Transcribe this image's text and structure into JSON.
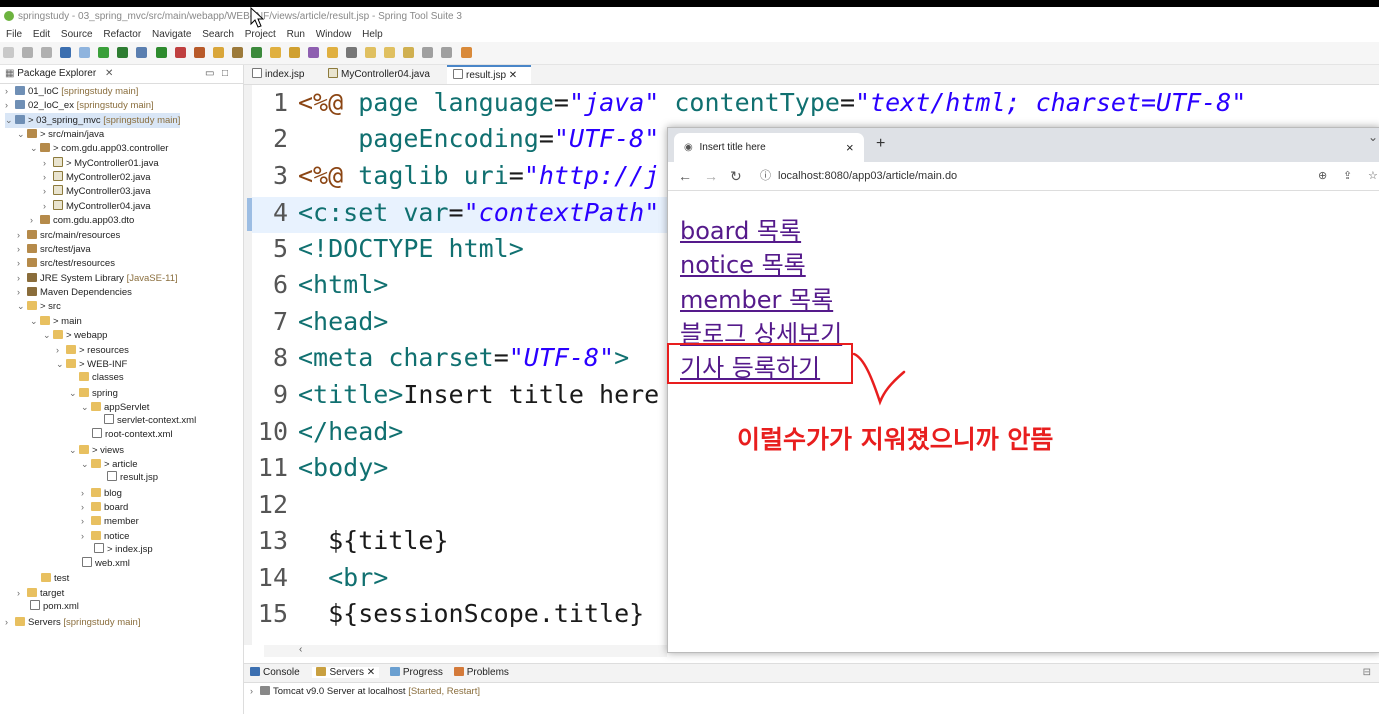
{
  "window": {
    "title": "springstudy - 03_spring_mvc/src/main/webapp/WEB-INF/views/article/result.jsp - Spring Tool Suite 3"
  },
  "menu": [
    "File",
    "Edit",
    "Source",
    "Refactor",
    "Navigate",
    "Search",
    "Project",
    "Run",
    "Window",
    "Help"
  ],
  "package_explorer": {
    "title": "Package Explorer",
    "items": [
      {
        "label": "01_IoC",
        "decor": "[springstudy main]"
      },
      {
        "label": "02_IoC_ex",
        "decor": "[springstudy main]"
      },
      {
        "label": "> 03_spring_mvc",
        "decor": "[springstudy main]"
      },
      {
        "label": "> src/main/java",
        "decor": ""
      },
      {
        "label": "> com.gdu.app03.controller",
        "decor": ""
      },
      {
        "label": "> MyController01.java",
        "decor": ""
      },
      {
        "label": "MyController02.java",
        "decor": ""
      },
      {
        "label": "MyController03.java",
        "decor": ""
      },
      {
        "label": "MyController04.java",
        "decor": ""
      },
      {
        "label": "com.gdu.app03.dto",
        "decor": ""
      },
      {
        "label": "src/main/resources",
        "decor": ""
      },
      {
        "label": "src/test/java",
        "decor": ""
      },
      {
        "label": "src/test/resources",
        "decor": ""
      },
      {
        "label": "JRE System Library",
        "decor": "[JavaSE-11]"
      },
      {
        "label": "Maven Dependencies",
        "decor": ""
      },
      {
        "label": "> src",
        "decor": ""
      },
      {
        "label": "> main",
        "decor": ""
      },
      {
        "label": "> webapp",
        "decor": ""
      },
      {
        "label": "> resources",
        "decor": ""
      },
      {
        "label": "> WEB-INF",
        "decor": ""
      },
      {
        "label": "classes",
        "decor": ""
      },
      {
        "label": "spring",
        "decor": ""
      },
      {
        "label": "appServlet",
        "decor": ""
      },
      {
        "label": "servlet-context.xml",
        "decor": ""
      },
      {
        "label": "root-context.xml",
        "decor": ""
      },
      {
        "label": "> views",
        "decor": ""
      },
      {
        "label": "> article",
        "decor": ""
      },
      {
        "label": "result.jsp",
        "decor": ""
      },
      {
        "label": "blog",
        "decor": ""
      },
      {
        "label": "board",
        "decor": ""
      },
      {
        "label": "member",
        "decor": ""
      },
      {
        "label": "notice",
        "decor": ""
      },
      {
        "label": "> index.jsp",
        "decor": ""
      },
      {
        "label": "web.xml",
        "decor": ""
      },
      {
        "label": "test",
        "decor": ""
      },
      {
        "label": "target",
        "decor": ""
      },
      {
        "label": "pom.xml",
        "decor": ""
      },
      {
        "label": "Servers",
        "decor": "[springstudy main]"
      }
    ]
  },
  "editor_tabs": [
    "index.jsp",
    "MyController04.java",
    "result.jsp"
  ],
  "line_numbers": [
    "1",
    "2",
    "3",
    "4",
    "5",
    "6",
    "7",
    "8",
    "9",
    "10",
    "11",
    "12",
    "13",
    "14",
    "15"
  ],
  "bottom_panel": {
    "tabs": [
      "Console",
      "Servers",
      "Progress",
      "Problems"
    ],
    "server_row": "Tomcat v9.0 Server at localhost",
    "server_status": "[Started, Restart]"
  },
  "browser": {
    "tab_title": "Insert title here",
    "tab_close": "×",
    "new_tab": "+",
    "url": "localhost:8080/app03/article/main.do",
    "links": [
      "board 목록",
      "notice 목록",
      "member 목록",
      "블로그 상세보기",
      "기사 등록하기"
    ]
  },
  "annotation": {
    "note": "이럴수가가 지워졌으니까 안뜸",
    "color": "#e81e1e"
  }
}
